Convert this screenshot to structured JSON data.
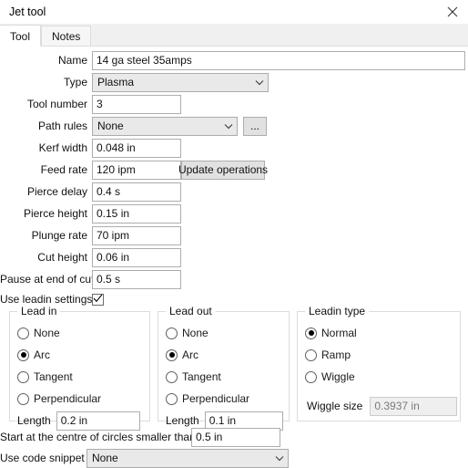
{
  "window": {
    "title": "Jet tool",
    "close_icon": "close-icon"
  },
  "tabs": [
    {
      "label": "Tool",
      "active": true
    },
    {
      "label": "Notes",
      "active": false
    }
  ],
  "fields": {
    "name": {
      "label": "Name",
      "value": "14 ga steel 35amps"
    },
    "type": {
      "label": "Type",
      "value": "Plasma"
    },
    "tool_number": {
      "label": "Tool number",
      "value": "3"
    },
    "path_rules": {
      "label": "Path rules",
      "value": "None",
      "browse_label": "..."
    },
    "kerf_width": {
      "label": "Kerf width",
      "value": "0.048 in"
    },
    "feed_rate": {
      "label": "Feed rate",
      "value": "120 ipm",
      "button_label": "Update operations"
    },
    "pierce_delay": {
      "label": "Pierce delay",
      "value": "0.4 s"
    },
    "pierce_height": {
      "label": "Pierce height",
      "value": "0.15 in"
    },
    "plunge_rate": {
      "label": "Plunge rate",
      "value": "70 ipm"
    },
    "cut_height": {
      "label": "Cut height",
      "value": "0.06 in"
    },
    "pause_end_cut": {
      "label": "Pause at end of cut",
      "value": "0.5 s"
    },
    "use_leadin_settings": {
      "label": "Use leadin settings",
      "checked": true
    },
    "start_centre_circles": {
      "label": "Start at the centre of circles smaller than",
      "value": "0.5 in"
    },
    "code_snippet": {
      "label": "Use code snippet",
      "value": "None"
    }
  },
  "lead_in": {
    "title": "Lead in",
    "options": [
      {
        "label": "None",
        "selected": false
      },
      {
        "label": "Arc",
        "selected": true
      },
      {
        "label": "Tangent",
        "selected": false
      },
      {
        "label": "Perpendicular",
        "selected": false
      }
    ],
    "length_label": "Length",
    "length_value": "0.2 in"
  },
  "lead_out": {
    "title": "Lead out",
    "options": [
      {
        "label": "None",
        "selected": false
      },
      {
        "label": "Arc",
        "selected": true
      },
      {
        "label": "Tangent",
        "selected": false
      },
      {
        "label": "Perpendicular",
        "selected": false
      }
    ],
    "length_label": "Length",
    "length_value": "0.1 in"
  },
  "leadin_type": {
    "title": "Leadin type",
    "options": [
      {
        "label": "Normal",
        "selected": true
      },
      {
        "label": "Ramp",
        "selected": false
      },
      {
        "label": "Wiggle",
        "selected": false
      }
    ],
    "wiggle_size_label": "Wiggle size",
    "wiggle_size_value": "0.3937 in",
    "wiggle_size_disabled": true
  }
}
